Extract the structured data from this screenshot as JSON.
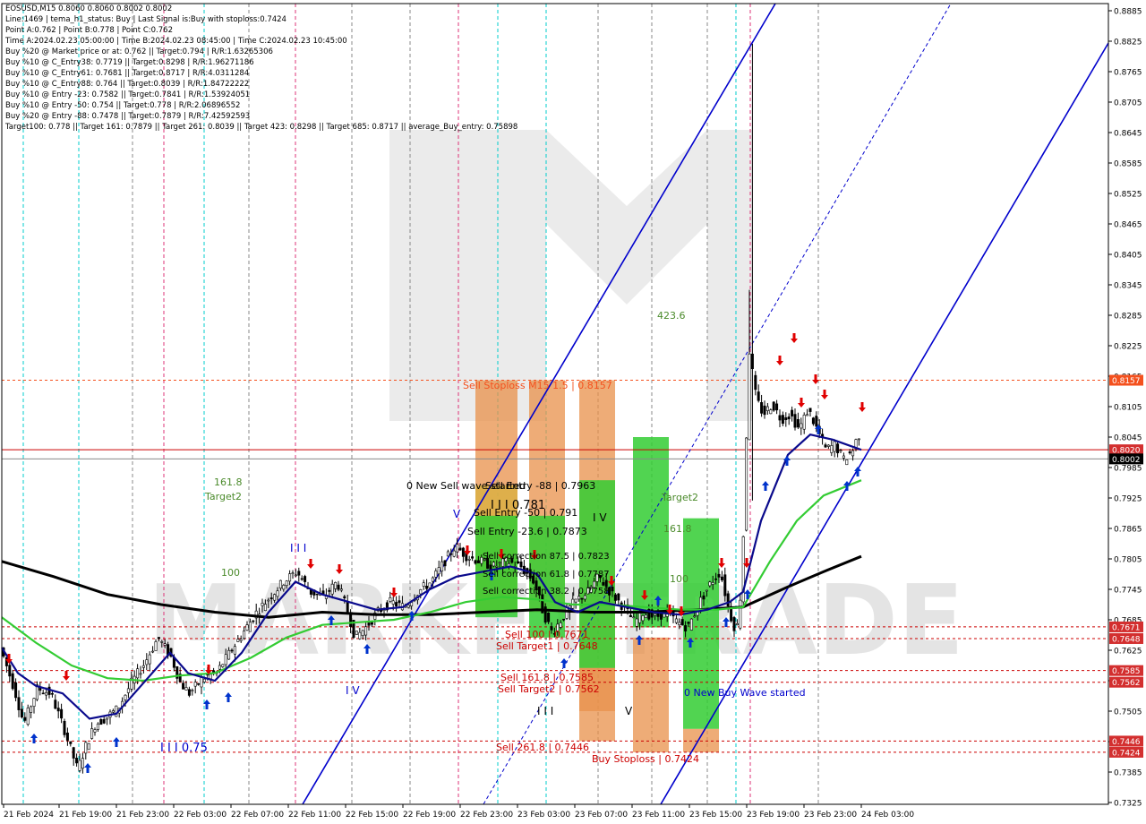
{
  "header": {
    "lines": [
      "EOSUSD,M15  0.8060 0.8060 0.8002 0.8002",
      "Line:1469  | tema_h1_status: Buy | Last Signal is:Buy with stoploss:0.7424",
      "Point A:0.762 | Point B:0.778 | Point C:0.762",
      "Time A:2024.02.23 05:00:00 | Time B:2024.02.23 08:45:00 | Time C:2024.02.23 10:45:00",
      "Buy %20 @ Market price or at: 0.762 || Target:0.794 | R/R:1.63265306",
      "Buy %10 @ C_Entry38: 0.7719 || Target:0.8298 | R/R:1.96271186",
      "Buy %10 @ C_Entry61: 0.7681 || Target:0.8717 | R/R:4.0311284",
      "Buy %10 @ C_Entry88: 0.764 || Target:0.8039 | R/R:1.84722222",
      "Buy %10 @ Entry -23: 0.7582 || Target:0.7841 | R/R:1.53924051",
      "Buy %10 @ Entry -50: 0.754 || Target:0.778 | R/R:2.06896552",
      "Buy %20 @ Entry -88: 0.7478 || Target:0.7879 | R/R:7.42592593",
      "Target100: 0.778 || Target 161: 0.7879 || Target 261: 0.8039 || Target 423: 0.8298 || Target 685: 0.8717 || average_Buy_entry: 0.75898"
    ]
  },
  "chart_data": {
    "type": "candlestick",
    "symbol": "EOSUSD,M15",
    "ylim": [
      0.7325,
      0.8885
    ],
    "price_ticks": [
      "0.8885",
      "0.8825",
      "0.8765",
      "0.8705",
      "0.8645",
      "0.8585",
      "0.8525",
      "0.8465",
      "0.8405",
      "0.8345",
      "0.8285",
      "0.8225",
      "0.8165",
      "0.8105",
      "0.8045",
      "0.7985",
      "0.7925",
      "0.7865",
      "0.7805",
      "0.7745",
      "0.7685",
      "0.7625",
      "0.7565",
      "0.7505",
      "0.7445",
      "0.7385",
      "0.7325"
    ],
    "time_labels": [
      "21 Feb 2024",
      "21 Feb 19:00",
      "21 Feb 23:00",
      "22 Feb 03:00",
      "22 Feb 07:00",
      "22 Feb 11:00",
      "22 Feb 15:00",
      "22 Feb 19:00",
      "22 Feb 23:00",
      "23 Feb 03:00",
      "23 Feb 07:00",
      "23 Feb 11:00",
      "23 Feb 15:00",
      "23 Feb 19:00",
      "23 Feb 23:00",
      "24 Feb 03:00"
    ],
    "price_badges": [
      {
        "value": "0.8157",
        "color": "#f4511e"
      },
      {
        "value": "0.8020",
        "color": "#d32f2f"
      },
      {
        "value": "0.8002",
        "color": "#000000"
      },
      {
        "value": "0.7671",
        "color": "#d32f2f"
      },
      {
        "value": "0.7648",
        "color": "#d32f2f"
      },
      {
        "value": "0.7585",
        "color": "#d32f2f"
      },
      {
        "value": "0.7562",
        "color": "#d32f2f"
      },
      {
        "value": "0.7446",
        "color": "#d32f2f"
      },
      {
        "value": "0.7424",
        "color": "#d32f2f"
      }
    ],
    "annotations": {
      "sell_stoploss": "Sell Stoploss M15 1.5 | 0.8157",
      "new_sell_wave": "0 New Sell wave started",
      "sell_entry_88": "Sell Entry -88 | 0.7963",
      "sell_entry_50": "Sell Entry -50 | 0.791",
      "sell_entry_23": "Sell Entry -23.6 | 0.7873",
      "sell_correction_87": "Sell correction 87.5 | 0.7823",
      "sell_correction_61": "Sell correction 61.8 | 0.7787",
      "sell_correction_38": "Sell correction 38.2 | 0.7758",
      "point_781": "I I I 0.781",
      "sell_100": "Sell 100 | 0.7671",
      "sell_target1": "Sell Target1 | 0.7648",
      "sell_161": "Sell 161.8 | 0.7585",
      "sell_target2": "Sell Target2 | 0.7562",
      "sell_261": "Sell 261.8 | 0.7446",
      "buy_stoploss": "Buy Stoploss | 0.7424",
      "new_buy_wave": "0 New Buy Wave started",
      "fib_423": "423.6",
      "fib_161": "161.8",
      "target2_left": "Target2",
      "fib_100_left": "100",
      "target2_mid": "Target2",
      "fib_161_mid": "161.8",
      "fib_100_mid": "100",
      "wave_iii_left": "I I I",
      "wave_iv_left": "I V",
      "wave_iii_075": "I I I 0.75",
      "wave_v_top": "V",
      "wave_iv_mid": "I V",
      "wave_iii_bottom": "I I I",
      "wave_v_bottom": "V"
    },
    "colors": {
      "ma_black": "#000000",
      "ma_navy": "#0a0a8c",
      "ma_green": "#33cc33",
      "channel": "#0000cc",
      "sell_zone": "#e8904a",
      "buy_zone": "#33cc33",
      "resistance": "#cc0000"
    }
  }
}
